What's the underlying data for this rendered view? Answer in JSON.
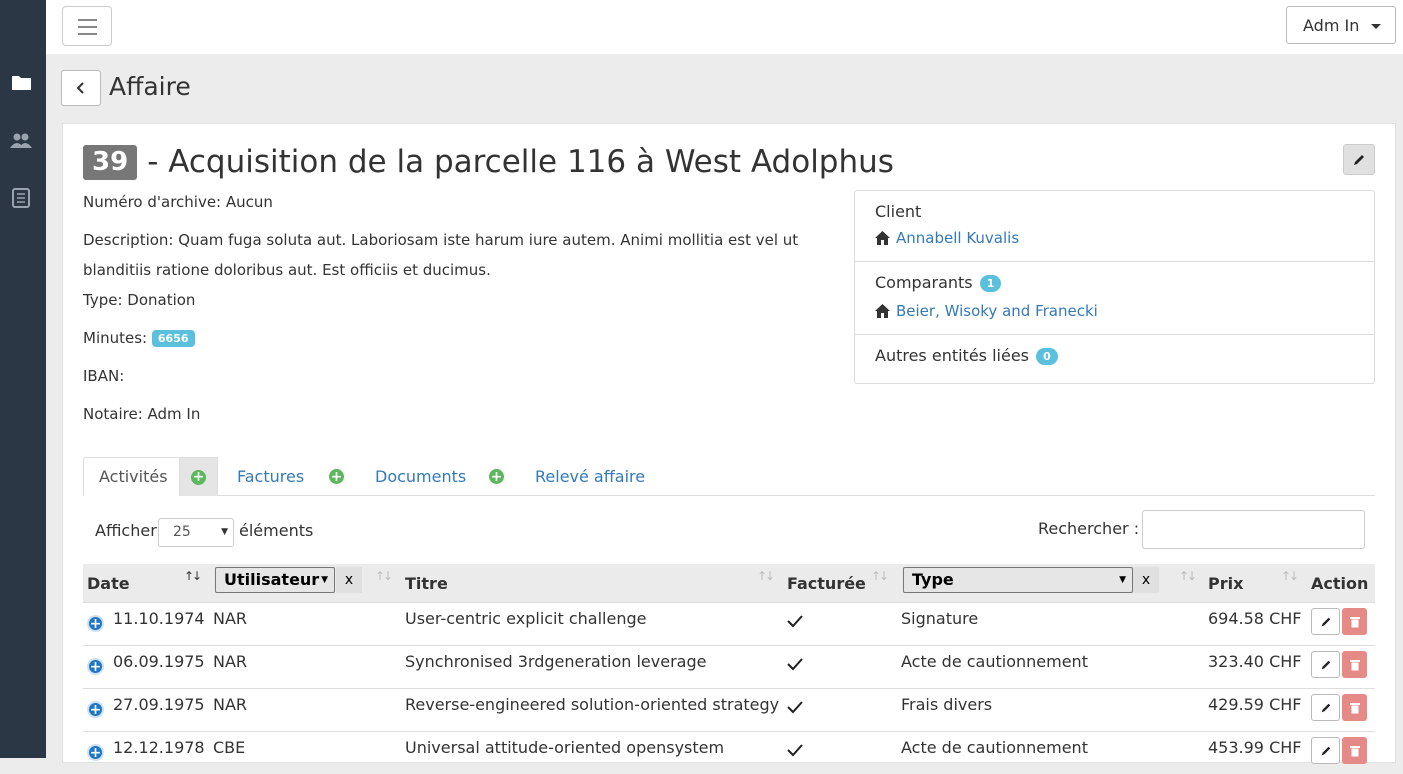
{
  "sidebar": {
    "icons": [
      "folder-icon",
      "users-icon",
      "book-icon"
    ]
  },
  "topbar": {
    "user_name": "Adm In"
  },
  "page": {
    "title": "Affaire"
  },
  "affaire": {
    "id": "39",
    "title": "- Acquisition de la parcelle 116 à West Adolphus",
    "archive": "Numéro d'archive: Aucun",
    "description_line1": "Description: Quam fuga soluta aut. Laboriosam iste harum iure autem. Animi mollitia est vel ut",
    "description_line2": "blanditiis ratione doloribus aut. Est officiis et ducimus.",
    "type": "Type: Donation",
    "minutes_label": "Minutes:",
    "minutes_value": "6656",
    "iban": "IBAN:",
    "notaire": "Notaire: Adm In"
  },
  "panel": {
    "client_title": "Client",
    "client_name": "Annabell Kuvalis",
    "comparants_title": "Comparants",
    "comparants_count": "1",
    "comparant_name": "Beier, Wisoky and Franecki",
    "autres_title": "Autres entités liées",
    "autres_count": "0"
  },
  "tabs": [
    "Activités",
    "Factures",
    "Documents",
    "Relevé affaire"
  ],
  "table_controls": {
    "show_label": "Afficher",
    "page_length": "25",
    "elements_label": "éléments",
    "search_label": "Rechercher :"
  },
  "columns": {
    "date": "Date",
    "user_filter": "Utilisateur",
    "title": "Titre",
    "billed": "Facturée",
    "type_filter": "Type",
    "price": "Prix",
    "action": "Action",
    "clear": "x"
  },
  "rows": [
    {
      "date": "11.10.1974",
      "user": "NAR",
      "title": "User-centric explicit challenge",
      "billed": true,
      "type": "Signature",
      "price": "694.58 CHF"
    },
    {
      "date": "06.09.1975",
      "user": "NAR",
      "title": "Synchronised 3rdgeneration leverage",
      "billed": true,
      "type": "Acte de cautionnement",
      "price": "323.40 CHF"
    },
    {
      "date": "27.09.1975",
      "user": "NAR",
      "title": "Reverse-engineered solution-oriented strategy",
      "billed": true,
      "type": "Frais divers",
      "price": "429.59 CHF"
    },
    {
      "date": "12.12.1978",
      "user": "CBE",
      "title": "Universal attitude-oriented opensystem",
      "billed": true,
      "type": "Acte de cautionnement",
      "price": "453.99 CHF"
    }
  ],
  "colors": {
    "sidebar": "#2b3744",
    "link": "#337ab7",
    "badge": "#5bc0de",
    "add": "#5cb85c",
    "danger": "#e58a87"
  }
}
